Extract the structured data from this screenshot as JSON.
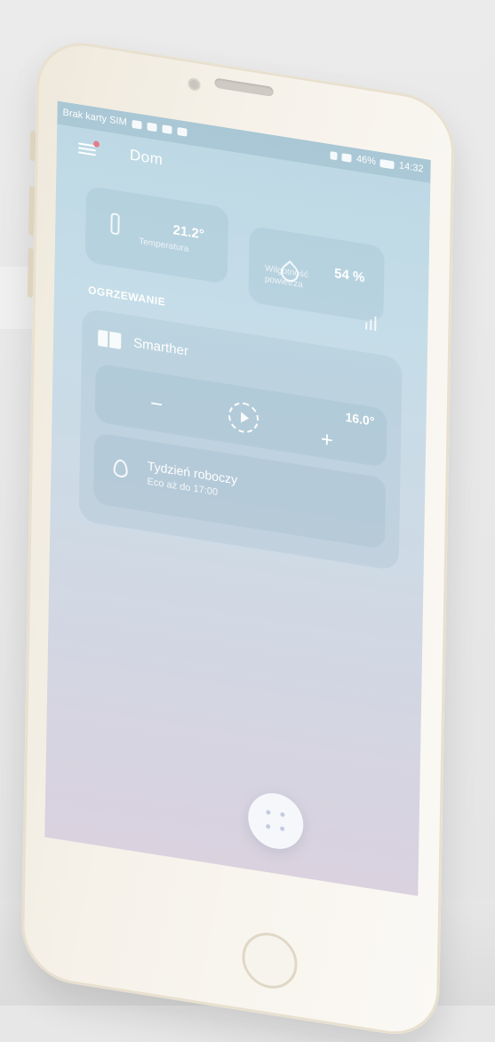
{
  "statusbar": {
    "carrier": "Brak karty SIM",
    "battery": "46%",
    "time": "14:32"
  },
  "appbar": {
    "title": "Dom"
  },
  "sensors": {
    "temperature": {
      "value": "21.2°",
      "label": "Temperatura"
    },
    "humidity": {
      "value": "54 %",
      "label": "Wilgotność powietrza"
    }
  },
  "heating": {
    "section_title": "OGRZEWANIE",
    "device_name": "Smarther",
    "setpoint": "16.0°",
    "minus_label": "−",
    "plus_label": "+",
    "program_name": "Tydzień roboczy",
    "program_detail": "Eco aż do 17:00"
  },
  "icons": {
    "menu": "hamburger-menu-icon",
    "thermometer": "thermometer-icon",
    "humidity": "water-drop-icon",
    "chart": "bar-chart-icon",
    "device": "thermostat-device-icon",
    "play": "play-icon",
    "flame": "flame-icon",
    "fab": "dots-grid-icon"
  },
  "colors": {
    "screen_top": "#aed0df",
    "screen_bottom": "#d2c8d8",
    "notification_dot": "#e06070",
    "phone_body": "#f6f2ea"
  }
}
